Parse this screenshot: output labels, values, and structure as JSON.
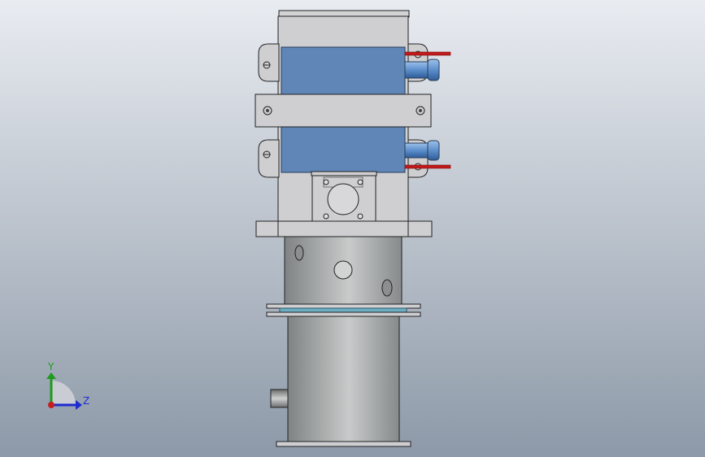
{
  "viewport": {
    "background_top": "#e9ecf1",
    "background_bottom": "#8d99a8"
  },
  "model": {
    "frame_color": "#cfcfd2",
    "body_blue": "#5f86b7",
    "fitting_blue": "#6fa0d7",
    "wire_red": "#c21a1a",
    "cylinder_light": "#c9cbcb",
    "cylinder_dark": "#7f8383",
    "spacer_teal": "#6eaec2"
  },
  "triad": {
    "y_label": "Y",
    "z_label": "Z",
    "y_color": "#1d9b1d",
    "z_color": "#1e2ccf",
    "x_color": "#c41e1e"
  }
}
